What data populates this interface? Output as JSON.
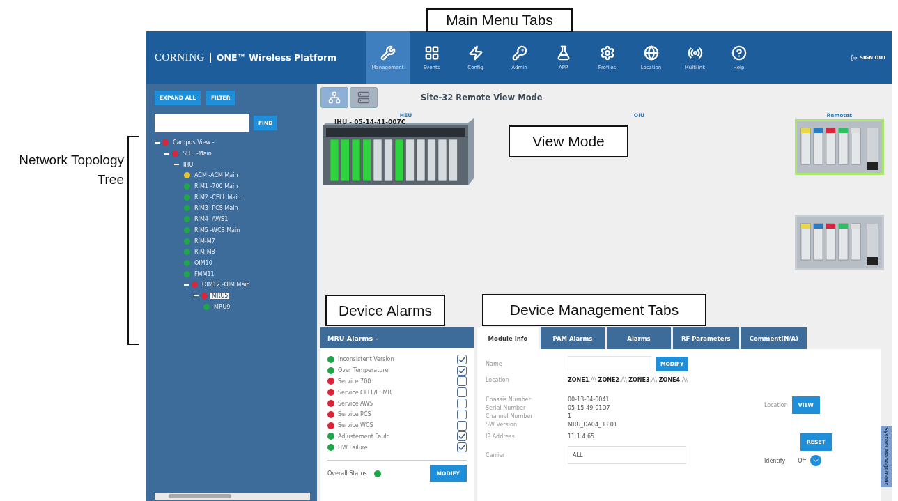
{
  "annotations": {
    "main_menu": "Main Menu Tabs",
    "tree": "Network Topology Tree",
    "view_mode": "View Mode",
    "device_alarms": "Device Alarms",
    "device_tabs": "Device Management Tabs"
  },
  "header": {
    "brand": "CORNING",
    "product": "ONE™ Wireless Platform",
    "sign_out": "SIGN OUT"
  },
  "nav_tabs": [
    {
      "label": "Management",
      "selected": true
    },
    {
      "label": "Events",
      "selected": false
    },
    {
      "label": "Config",
      "selected": false
    },
    {
      "label": "Admin",
      "selected": false
    },
    {
      "label": "APP",
      "selected": false
    },
    {
      "label": "Profiles",
      "selected": false
    },
    {
      "label": "Location",
      "selected": false
    },
    {
      "label": "Multilink",
      "selected": false
    },
    {
      "label": "Help",
      "selected": false
    }
  ],
  "sidebar": {
    "buttons": [
      "EXPAND ALL",
      "FILTER"
    ],
    "find_button": "FIND",
    "tree": [
      {
        "label": "Campus View -",
        "color": "#d9263a",
        "expanded": true,
        "selected": false,
        "children": [
          {
            "label": "SITE -Main",
            "color": "#d9263a",
            "expanded": true,
            "selected": false,
            "children": [
              {
                "label": "IHU",
                "expanded": true,
                "selected": false,
                "children": [
                  {
                    "label": "ACM -ACM Main",
                    "color": "#e8c532",
                    "selected": false
                  },
                  {
                    "label": "RIM1 -700 Main",
                    "color": "#1fa64a",
                    "selected": false
                  },
                  {
                    "label": "RIM2 -CELL Main",
                    "color": "#1fa64a",
                    "selected": false
                  },
                  {
                    "label": "RIM3 -PCS Main",
                    "color": "#1fa64a",
                    "selected": false
                  },
                  {
                    "label": "RIM4 -AWS1",
                    "color": "#1fa64a",
                    "selected": false
                  },
                  {
                    "label": "RIM5 -WCS Main",
                    "color": "#1fa64a",
                    "selected": false
                  },
                  {
                    "label": "RIM-M7",
                    "color": "#1fa64a",
                    "selected": false
                  },
                  {
                    "label": "RIM-M8",
                    "color": "#1fa64a",
                    "selected": false
                  },
                  {
                    "label": "OIM10",
                    "color": "#1fa64a",
                    "selected": false
                  },
                  {
                    "label": "FMM11",
                    "color": "#1fa64a",
                    "selected": false
                  },
                  {
                    "label": "OIM12 -OIM Main",
                    "color": "#d9263a",
                    "expanded": true,
                    "selected": false,
                    "children": [
                      {
                        "label": "MRU5",
                        "color": "#d9263a",
                        "expanded": true,
                        "selected": true,
                        "children": [
                          {
                            "label": "MRU9",
                            "color": "#1fa64a",
                            "selected": false
                          }
                        ]
                      }
                    ]
                  }
                ]
              }
            ]
          }
        ]
      }
    ]
  },
  "view": {
    "title": "Site-32 Remote View Mode",
    "columns": [
      "HEU",
      "OIU",
      "Remotes"
    ],
    "chassis_label": "IHU - 05-14-41-007C"
  },
  "alarms": {
    "title": "MRU Alarms -",
    "items": [
      {
        "label": "Inconsistent Version",
        "color": "#1fa64a",
        "checked": true
      },
      {
        "label": "Over Temperature",
        "color": "#1fa64a",
        "checked": true
      },
      {
        "label": "Service 700",
        "color": "#d9263a",
        "checked": false
      },
      {
        "label": "Service CELL/ESMR",
        "color": "#d9263a",
        "checked": false
      },
      {
        "label": "Service AWS",
        "color": "#d9263a",
        "checked": false
      },
      {
        "label": "Service PCS",
        "color": "#d9263a",
        "checked": false
      },
      {
        "label": "Service WCS",
        "color": "#d9263a",
        "checked": false
      },
      {
        "label": "Adjustement Fault",
        "color": "#1fa64a",
        "checked": true
      },
      {
        "label": "HW Failure",
        "color": "#1fa64a",
        "checked": true
      }
    ],
    "overall_label": "Overall Status",
    "overall_fault": false,
    "button": "MODIFY"
  },
  "module_tabs": [
    {
      "label": "Module Info",
      "selected": true
    },
    {
      "label": "PAM Alarms",
      "selected": false
    },
    {
      "label": "Alarms",
      "selected": false
    },
    {
      "label": "RF Parameters",
      "selected": false
    },
    {
      "label": "Comment(N/A)",
      "selected": false
    }
  ],
  "module_info": {
    "name_label": "Name",
    "modify_button": "MODIFY",
    "location_label": "Location",
    "location_value": "**ZONE1**.A\\ **ZONE2**.A\\ **ZONE3**.A\\ **ZONE4**.A\\",
    "details": [
      {
        "label": "Chassis Number",
        "value": "00-13-04-0041"
      },
      {
        "label": "Serial Number",
        "value": "05-15-49-01D7"
      },
      {
        "label": "Channel Number",
        "value": "1"
      },
      {
        "label": "SW Version",
        "value": "MRU_DA04_33.01"
      }
    ],
    "ip_label": "IP Address",
    "ip_value": "11.1.4.65",
    "carrier_label": "Carrier",
    "carrier_value": "ALL",
    "view_label": "Location",
    "view_button": "VIEW",
    "reset_button": "RESET",
    "identify_label": "Identify",
    "identify_value": "Off"
  },
  "side_tab": "System Management"
}
